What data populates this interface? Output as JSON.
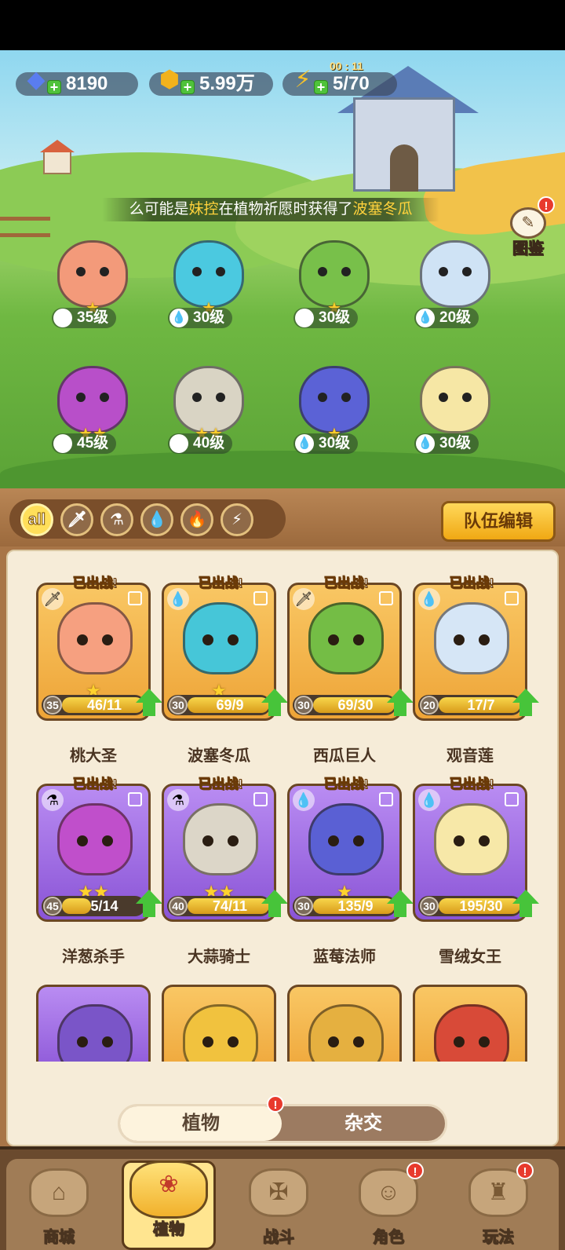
{
  "resources": {
    "gems": "8190",
    "gold": "5.99万",
    "energy": "5/70",
    "energy_timer": "00 : 11"
  },
  "marquee": {
    "prefix": "么可能是",
    "player": "妹控",
    "middle": "在植物祈愿时获得了",
    "item": "波塞冬瓜"
  },
  "codex": {
    "label": "图鉴",
    "badge": "!"
  },
  "field": [
    {
      "level": "35级",
      "type_icon": "sword-icon",
      "stars": "★",
      "color": "#f39a7a"
    },
    {
      "level": "30级",
      "type_icon": "water-drop-icon",
      "stars": "★",
      "color": "#4bc9e0"
    },
    {
      "level": "30级",
      "type_icon": "sword-icon",
      "stars": "★",
      "color": "#78c04a"
    },
    {
      "level": "20级",
      "type_icon": "water-drop-icon",
      "stars": "",
      "color": "#cfe3f5"
    },
    {
      "level": "45级",
      "type_icon": "potion-icon",
      "stars": "★★",
      "color": "#b84fc9"
    },
    {
      "level": "40级",
      "type_icon": "potion-icon",
      "stars": "★★",
      "color": "#d9d4c4"
    },
    {
      "level": "30级",
      "type_icon": "water-drop-icon",
      "stars": "★",
      "color": "#5b62d6"
    },
    {
      "level": "30级",
      "type_icon": "water-drop-icon",
      "stars": "",
      "color": "#f6e7a5"
    }
  ],
  "filters": [
    {
      "label": "all",
      "icon": "all-icon"
    },
    {
      "label": "",
      "icon": "sword-icon"
    },
    {
      "label": "",
      "icon": "potion-icon"
    },
    {
      "label": "",
      "icon": "water-drop-icon"
    },
    {
      "label": "",
      "icon": "fire-icon"
    },
    {
      "label": "",
      "icon": "lightning-icon"
    }
  ],
  "edit_team_label": "队伍编辑",
  "deployed_label": "已出战!",
  "cards": [
    {
      "name": "桃大圣",
      "level": "35",
      "progress": "46/11",
      "stars": "★",
      "theme": "gold",
      "type_icon": "sword-icon",
      "art": "#f6a080"
    },
    {
      "name": "波塞冬瓜",
      "level": "30",
      "progress": "69/9",
      "stars": "★",
      "theme": "gold",
      "type_icon": "water-drop-icon",
      "art": "#46c6d8"
    },
    {
      "name": "西瓜巨人",
      "level": "30",
      "progress": "69/30",
      "stars": "",
      "theme": "gold",
      "type_icon": "sword-icon",
      "art": "#74bd45"
    },
    {
      "name": "观音莲",
      "level": "20",
      "progress": "17/7",
      "stars": "",
      "theme": "gold",
      "type_icon": "water-drop-icon",
      "art": "#d6e6f6"
    },
    {
      "name": "洋葱杀手",
      "level": "45",
      "progress": "5/14",
      "stars": "★★",
      "theme": "purple",
      "type_icon": "potion-icon",
      "art": "#c04fcb"
    },
    {
      "name": "大蒜骑士",
      "level": "40",
      "progress": "74/11",
      "stars": "★★",
      "theme": "purple",
      "type_icon": "potion-icon",
      "art": "#dcd6c8"
    },
    {
      "name": "蓝莓法师",
      "level": "30",
      "progress": "135/9",
      "stars": "★",
      "theme": "purple",
      "type_icon": "water-drop-icon",
      "art": "#5a60d4"
    },
    {
      "name": "雪绒女王",
      "level": "30",
      "progress": "195/30",
      "stars": "",
      "theme": "purple",
      "type_icon": "water-drop-icon",
      "art": "#f7e8a8"
    }
  ],
  "toggle": {
    "plants": "植物",
    "hybrid": "杂交",
    "badge": "!"
  },
  "nav": [
    {
      "label": "商城",
      "icon": "shop-icon",
      "badge": ""
    },
    {
      "label": "植物",
      "icon": "plants-icon",
      "badge": ""
    },
    {
      "label": "战斗",
      "icon": "battle-icon",
      "badge": ""
    },
    {
      "label": "角色",
      "icon": "character-icon",
      "badge": "!"
    },
    {
      "label": "玩法",
      "icon": "gameplay-icon",
      "badge": "!"
    }
  ]
}
